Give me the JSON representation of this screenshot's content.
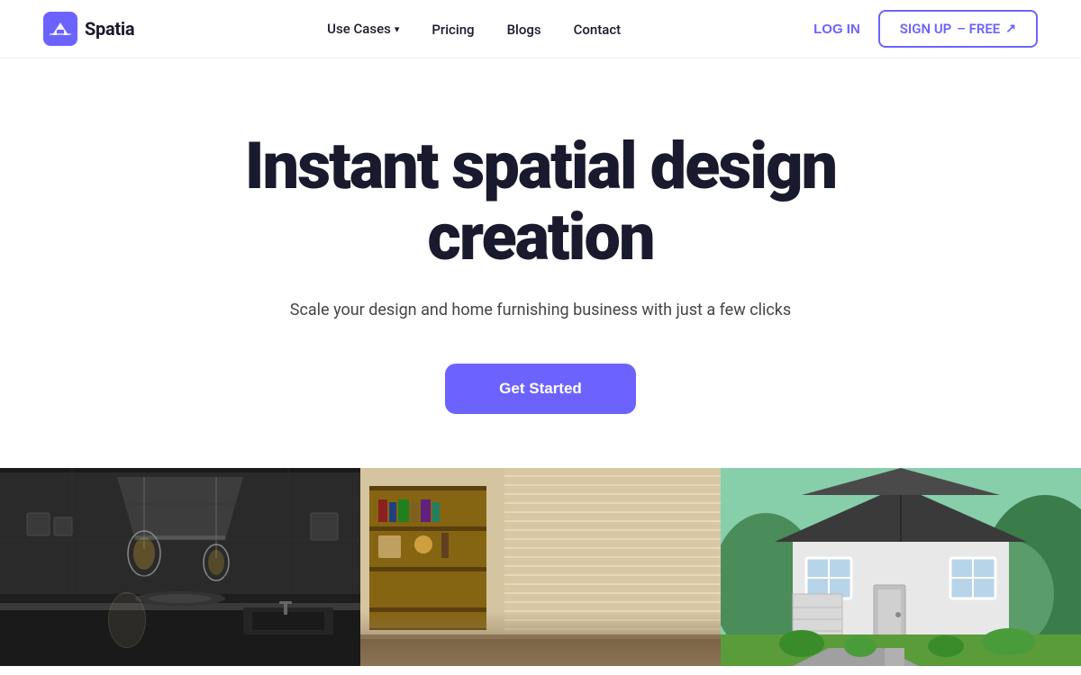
{
  "brand": {
    "name": "Spatia",
    "logo_alt": "Spatia logo"
  },
  "nav": {
    "use_cases_label": "Use Cases",
    "pricing_label": "Pricing",
    "blogs_label": "Blogs",
    "contact_label": "Contact",
    "login_label": "LOG IN",
    "signup_label": "SIGN UP",
    "signup_suffix": "– FREE"
  },
  "hero": {
    "title_line1": "Instant spatial design",
    "title_line2": "creation",
    "subtitle": "Scale your design and home furnishing business with just a few clicks",
    "cta_label": "Get Started"
  },
  "colors": {
    "accent": "#6c63ff",
    "text_dark": "#1a1a2e",
    "text_muted": "#444444"
  },
  "images": [
    {
      "id": "kitchen",
      "alt": "Modern dark kitchen interior"
    },
    {
      "id": "living",
      "alt": "Warm living room with shelves"
    },
    {
      "id": "house",
      "alt": "White house exterior with green lawn"
    }
  ]
}
